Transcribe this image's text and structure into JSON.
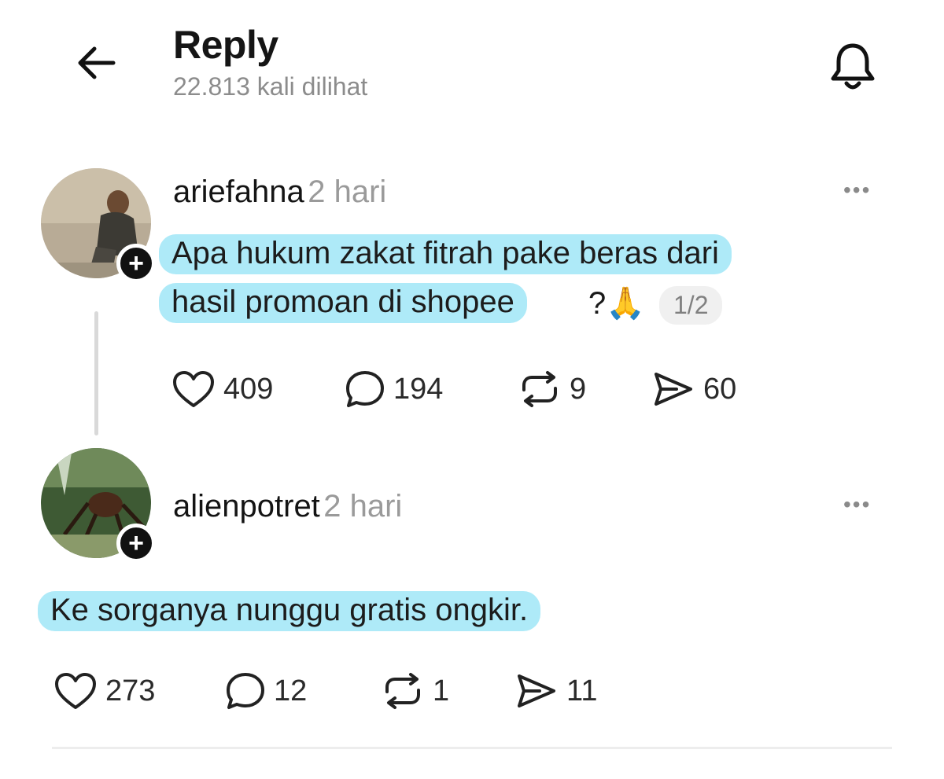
{
  "header": {
    "title": "Reply",
    "views": "22.813 kali dilihat"
  },
  "posts": [
    {
      "username": "ariefahna",
      "time": "2 hari",
      "text_line1": "Apa hukum zakat fitrah pake beras dari",
      "text_line2": "hasil promoan di shopee",
      "text_tail": "?🙏",
      "page_badge": "1/2",
      "likes": "409",
      "comments": "194",
      "reposts": "9",
      "shares": "60"
    },
    {
      "username": "alienpotret",
      "time": "2 hari",
      "text_line1": "Ke sorganya nunggu gratis ongkir.",
      "likes": "273",
      "comments": "12",
      "reposts": "1",
      "shares": "11"
    }
  ],
  "icons": {
    "back": "arrow-left-icon",
    "bell": "bell-icon",
    "more": "more-horizontal-icon",
    "like": "heart-icon",
    "comment": "comment-icon",
    "repost": "repost-icon",
    "share": "send-icon",
    "follow": "plus-icon"
  },
  "colors": {
    "highlight": "#aeeaf8",
    "muted": "#9a9a9a"
  }
}
